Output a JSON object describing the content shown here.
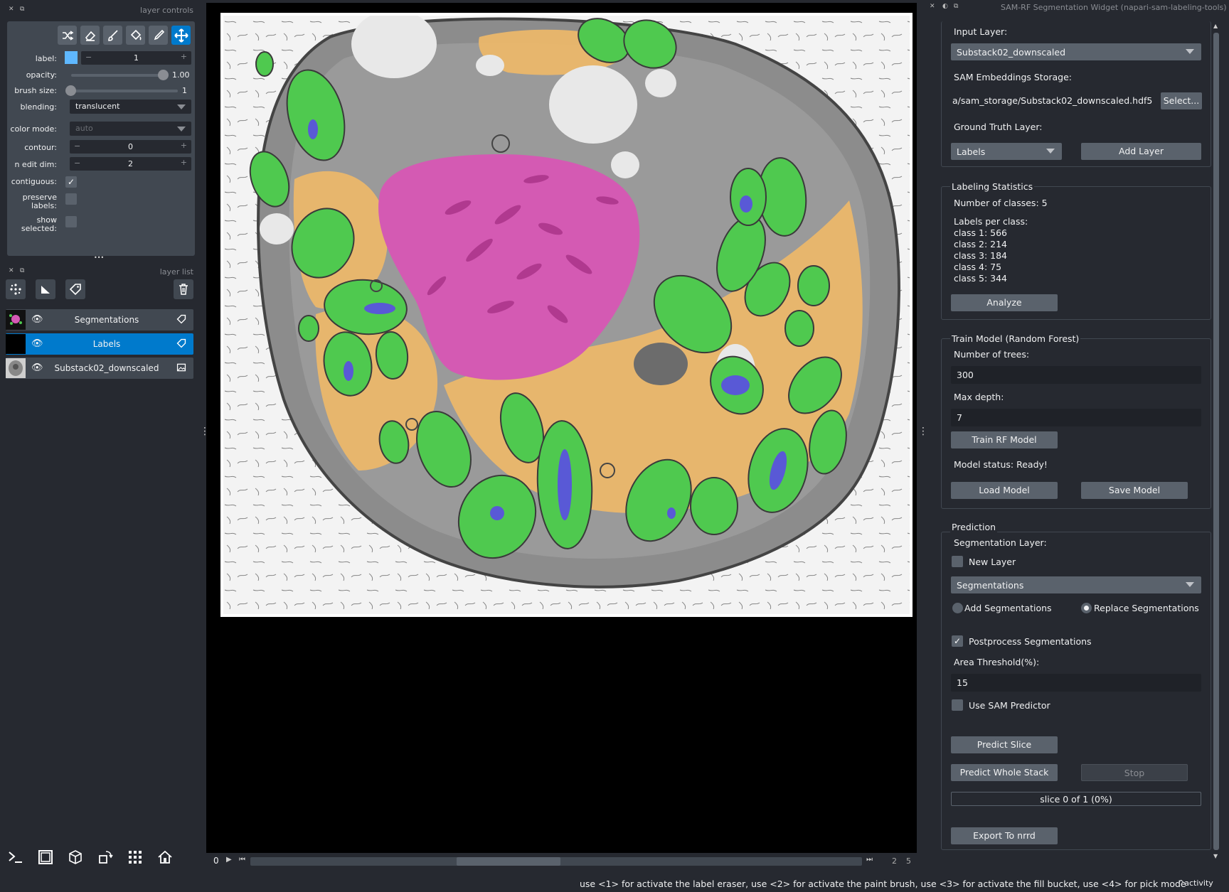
{
  "left_dock": {
    "layer_controls_title": "layer controls",
    "layer_list_title": "layer list",
    "tools": [
      "shuffle-icon",
      "eraser-icon",
      "brush-icon",
      "fill-bucket-icon",
      "picker-icon",
      "move-icon"
    ],
    "label_label": "label:",
    "label_value": "1",
    "label_color": "#5fb8ff",
    "opacity_label": "opacity:",
    "opacity_value": "1.00",
    "brush_size_label": "brush size:",
    "brush_size_value": "1",
    "blending_label": "blending:",
    "blending_value": "translucent",
    "color_mode_label": "color mode:",
    "color_mode_value": "auto",
    "contour_label": "contour:",
    "contour_value": "0",
    "n_edit_dim_label": "n edit dim:",
    "n_edit_dim_value": "2",
    "contiguous_label": "contiguous:",
    "preserve_labels_label": "preserve labels:",
    "show_selected_label": "show selected:",
    "more_dots": "•••",
    "layers": [
      {
        "name": "Segmentations",
        "type_icon": "label-tag-icon",
        "selected": false
      },
      {
        "name": "Labels",
        "type_icon": "label-tag-icon",
        "selected": true
      },
      {
        "name": "Substack02_downscaled",
        "type_icon": "image-icon",
        "selected": false
      }
    ]
  },
  "dims": {
    "current": "0",
    "range_low": "2",
    "range_high": "5"
  },
  "right_dock": {
    "title": "SAM-RF Segmentation Widget (napari-sam-labeling-tools)",
    "input_layer_label": "Input Layer:",
    "input_layer_value": "Substack02_downscaled",
    "sam_storage_label": "SAM Embeddings Storage:",
    "sam_storage_value": "a/sam_storage/Substack02_downscaled.hdf5",
    "select_button": "Select...",
    "gt_layer_label": "Ground Truth Layer:",
    "gt_layer_value": "Labels",
    "add_layer_button": "Add Layer",
    "labeling_stats_title": "Labeling Statistics",
    "num_classes": "Number of classes: 5",
    "labels_per_class": "Labels per class:",
    "class_counts": [
      "class 1: 566",
      "class 2: 214",
      "class 3: 184",
      "class 4: 75",
      "class 5: 344"
    ],
    "analyze_button": "Analyze",
    "train_title": "Train Model (Random Forest)",
    "num_trees_label": "Number of trees:",
    "num_trees_value": "300",
    "max_depth_label": "Max depth:",
    "max_depth_value": "7",
    "train_button": "Train RF Model",
    "model_status": "Model status: Ready!",
    "load_model_button": "Load Model",
    "save_model_button": "Save Model",
    "prediction_title": "Prediction",
    "seg_layer_label": "Segmentation Layer:",
    "new_layer_label": "New Layer",
    "seg_layer_value": "Segmentations",
    "add_seg_label": "Add Segmentations",
    "replace_seg_label": "Replace Segmentations",
    "postprocess_label": "Postprocess Segmentations",
    "area_threshold_label": "Area Threshold(%):",
    "area_threshold_value": "15",
    "use_sam_label": "Use SAM Predictor",
    "predict_slice_button": "Predict Slice",
    "predict_stack_button": "Predict Whole Stack",
    "stop_button": "Stop",
    "progress_text": "slice 0 of 1 (0%)",
    "progress_value": 0,
    "export_button": "Export To nrrd"
  },
  "status": {
    "help_text": "use <1> for activate the label eraser, use <2> for activate the paint brush, use <3> for activate the fill bucket, use <4> for pick mode",
    "activity_label": "activity"
  },
  "colors": {
    "accent": "#007acc",
    "cell_green": "#4fc94f",
    "nucleus_magenta": "#d45ab3",
    "cytoplasm_orange": "#efb968",
    "nucleoid_blue": "#5959d6"
  }
}
